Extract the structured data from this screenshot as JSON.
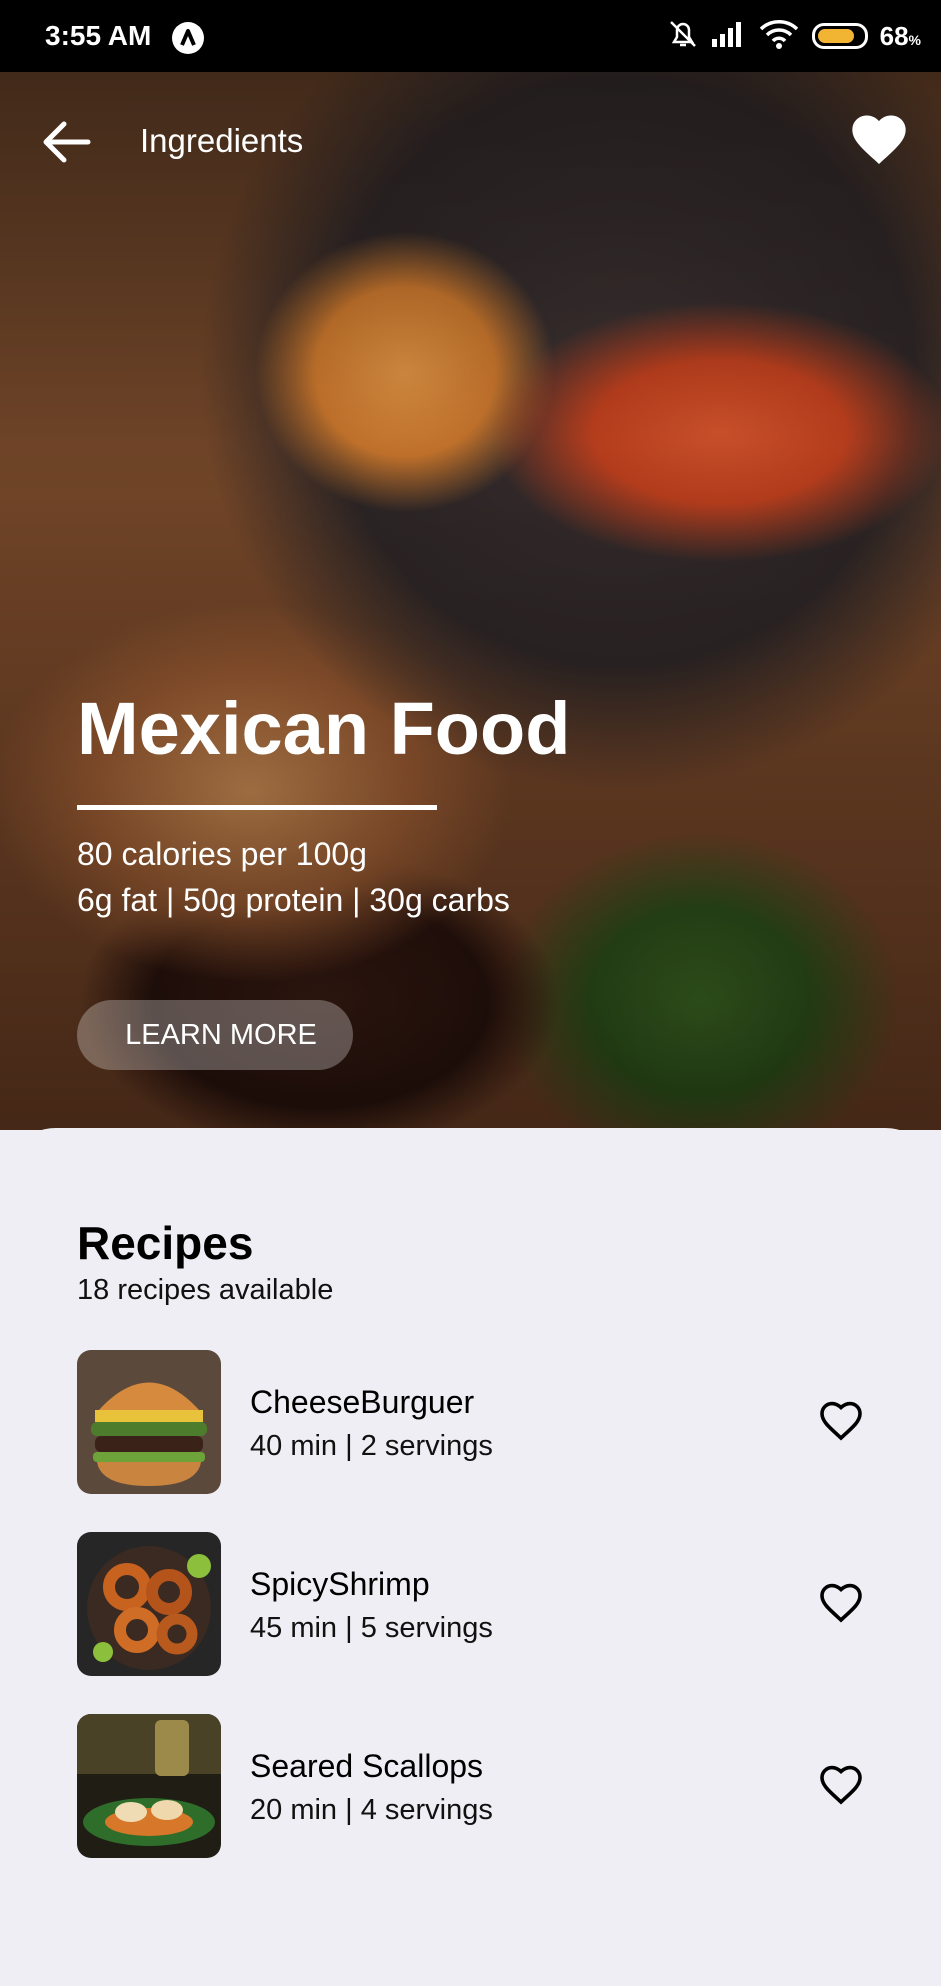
{
  "status": {
    "time": "3:55 AM",
    "battery": "68",
    "battery_unit": "%"
  },
  "header": {
    "title": "Ingredients"
  },
  "hero": {
    "title": "Mexican Food",
    "calories": "80 calories per 100g",
    "macros": "6g fat | 50g protein | 30g carbs",
    "button": "LEARN MORE"
  },
  "recipes": {
    "title": "Recipes",
    "subtitle": "18 recipes available",
    "items": [
      {
        "name": "CheeseBurguer",
        "meta": "40 min | 2 servings"
      },
      {
        "name": "SpicyShrimp",
        "meta": "45 min | 5 servings"
      },
      {
        "name": "Seared Scallops",
        "meta": "20 min | 4 servings"
      }
    ]
  }
}
